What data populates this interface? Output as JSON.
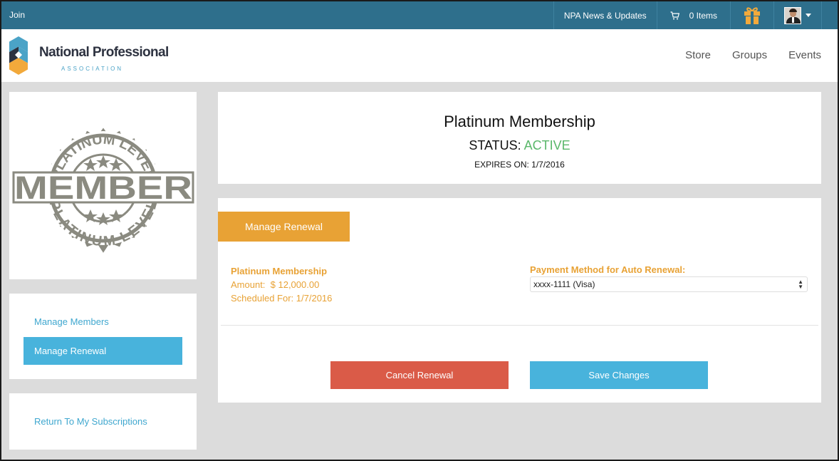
{
  "topbar": {
    "join": "Join",
    "news": "NPA News & Updates",
    "cart_items": "0 Items"
  },
  "brand": {
    "name": "National Professional",
    "sub": "ASSOCIATION"
  },
  "nav": [
    "Store",
    "Groups",
    "Events"
  ],
  "badge": {
    "text_top": "PLATINUM LEVEL",
    "text_main": "MEMBER",
    "text_bottom": "PLATINUM LEVEL",
    "color": "#8a8a80"
  },
  "sidebar": {
    "manage_members": "Manage Members",
    "manage_renewal": "Manage Renewal",
    "return": "Return To My Subscriptions"
  },
  "summary": {
    "title": "Platinum Membership",
    "status_label": "STATUS:",
    "status_value": "ACTIVE",
    "expires": "EXPIRES ON: 1/7/2016"
  },
  "renewal": {
    "tab": "Manage Renewal",
    "plan": "Platinum Membership",
    "amount": "Amount:  $ 12,000.00",
    "scheduled": "Scheduled For: 1/7/2016",
    "payment_label": "Payment Method for Auto Renewal:",
    "payment_value": "xxxx-1111 (Visa)",
    "cancel": "Cancel Renewal",
    "save": "Save Changes"
  },
  "colors": {
    "topbar": "#2e6f8c",
    "accent_orange": "#e8a235",
    "accent_blue": "#48b3dc",
    "danger": "#da5b48",
    "status_active": "#5ab76a"
  }
}
